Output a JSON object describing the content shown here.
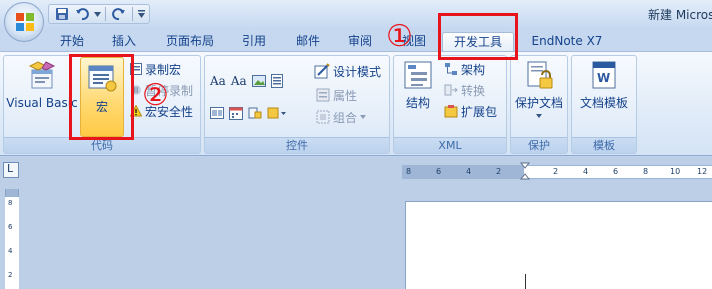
{
  "window": {
    "title": "新建 Micros"
  },
  "tabs": [
    {
      "label": "开始"
    },
    {
      "label": "插入"
    },
    {
      "label": "页面布局"
    },
    {
      "label": "引用"
    },
    {
      "label": "邮件"
    },
    {
      "label": "审阅"
    },
    {
      "label": "视图"
    },
    {
      "label": "开发工具"
    },
    {
      "label": "EndNote X7"
    }
  ],
  "active_tab": "开发工具",
  "ribbon": {
    "code_group": {
      "label": "代码",
      "visual_basic": "Visual Basic",
      "macro": "宏",
      "record_macro": "录制宏",
      "pause_recording": "暂停录制",
      "macro_security": "宏安全性"
    },
    "controls_group": {
      "label": "控件",
      "design_mode": "设计模式",
      "properties": "属性",
      "group": "组合"
    },
    "xml_group": {
      "label": "XML",
      "structure": "结构",
      "schema": "架构",
      "transform": "转换",
      "expansion_pack": "扩展包"
    },
    "protect_group": {
      "label": "保护",
      "protect_document": "保护文档"
    },
    "templates_group": {
      "label": "模板",
      "document_template": "文档模板"
    }
  },
  "annotations": {
    "step1": "①",
    "step2": "②",
    "color": "#e8141c"
  },
  "ruler": {
    "h_ticks": [
      "8",
      "6",
      "4",
      "2",
      "2",
      "4",
      "6",
      "8",
      "10",
      "12"
    ],
    "v_ticks": [
      "8",
      "6",
      "4",
      "2"
    ],
    "corner_symbol": "L"
  }
}
